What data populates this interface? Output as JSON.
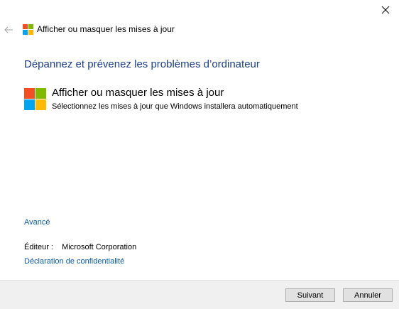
{
  "window": {
    "title": "Afficher ou masquer les mises à jour",
    "close_icon": "close-icon",
    "back_icon": "back-arrow-icon"
  },
  "main": {
    "heading": "Dépannez et prévenez les problèmes d’ordinateur",
    "tool": {
      "icon": "windows-logo-icon",
      "title": "Afficher ou masquer les mises à jour",
      "description": "Sélectionnez les mises à jour que Windows installera automatiquement"
    },
    "advanced_link": "Avancé",
    "publisher": {
      "label": "Éditeur :",
      "value": "Microsoft Corporation"
    },
    "privacy_link": "Déclaration de confidentialité"
  },
  "footer": {
    "next_label": "Suivant",
    "cancel_label": "Annuler"
  },
  "colors": {
    "heading": "#1a3d8f",
    "link": "#0b5ba8",
    "logo_red": "#f25022",
    "logo_green": "#7fba00",
    "logo_blue": "#00a4ef",
    "logo_yellow": "#ffb900"
  }
}
